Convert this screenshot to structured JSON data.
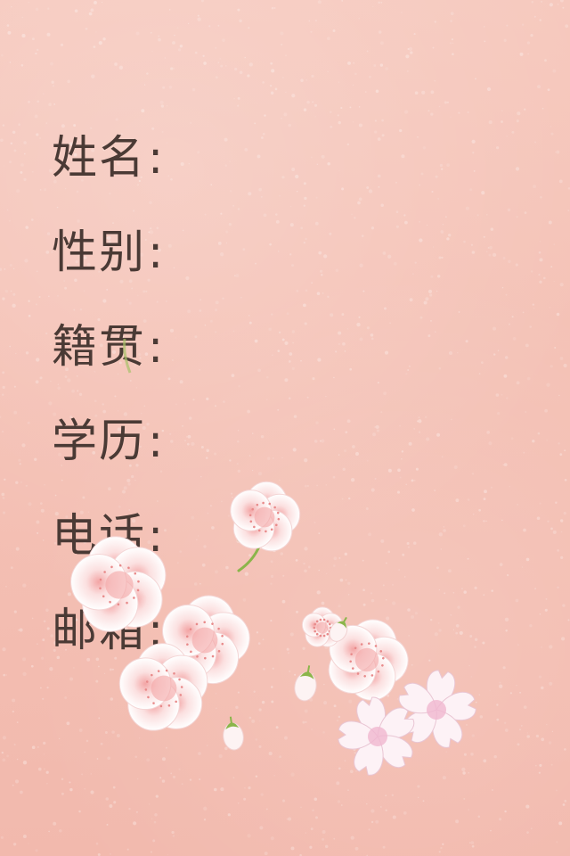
{
  "form": {
    "fields": [
      {
        "label": "姓名",
        "separator": ":"
      },
      {
        "label": "性别",
        "separator": ":"
      },
      {
        "label": "籍贯",
        "separator": ":"
      },
      {
        "label": "学历",
        "separator": ":"
      },
      {
        "label": "电话",
        "separator": ":"
      },
      {
        "label": "邮箱",
        "separator": ":"
      }
    ]
  },
  "colors": {
    "background": "#f4c0b4",
    "text": "#4a3a35",
    "petal": "#ffffff",
    "petal_center": "#f3a5a5",
    "leaf": "#8bb54a"
  },
  "decoration": {
    "background": "pink-speckled-paper",
    "illustration": "cherry-blossom-cluster"
  }
}
